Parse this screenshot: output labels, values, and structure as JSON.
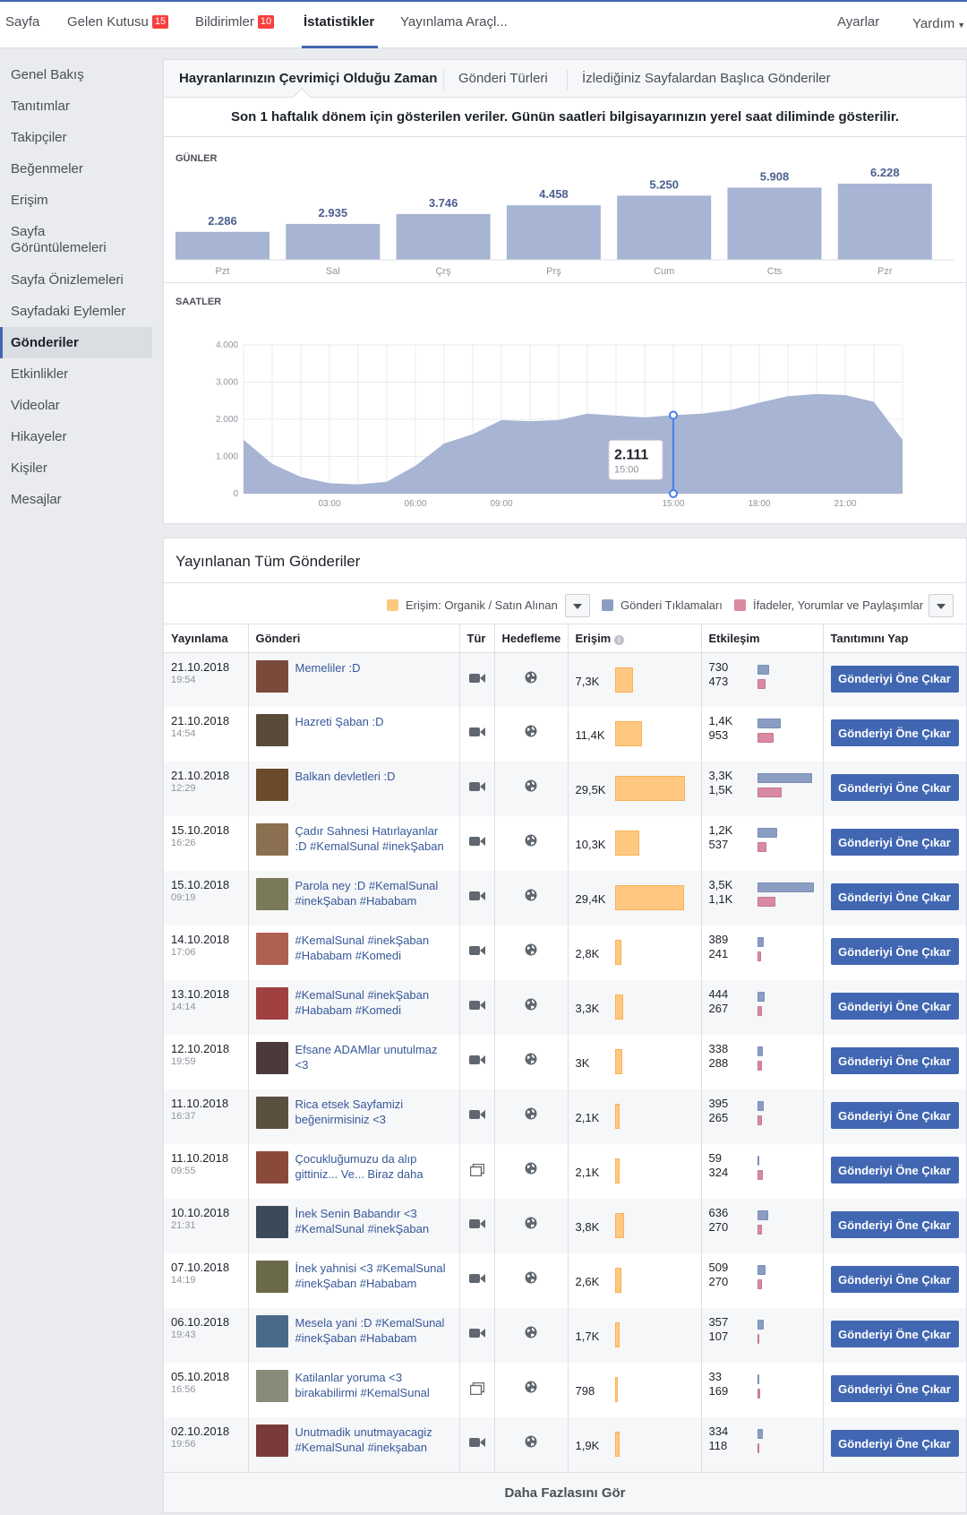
{
  "topnav": {
    "items": [
      {
        "label": "Sayfa",
        "badge": ""
      },
      {
        "label": "Gelen Kutusu",
        "badge": "15"
      },
      {
        "label": "Bildirimler",
        "badge": "10"
      },
      {
        "label": "İstatistikler",
        "badge": ""
      },
      {
        "label": "Yayınlama Araçl...",
        "badge": ""
      }
    ],
    "right": [
      "Ayarlar",
      "Yardım"
    ]
  },
  "sidebar": {
    "items": [
      "Genel Bakış",
      "Tanıtımlar",
      "Takipçiler",
      "Beğenmeler",
      "Erişim",
      "Sayfa Görüntülemeleri",
      "Sayfa Önizlemeleri",
      "Sayfadaki Eylemler",
      "Gönderiler",
      "Etkinlikler",
      "Videolar",
      "Hikayeler",
      "Kişiler",
      "Mesajlar"
    ],
    "active": "Gönderiler"
  },
  "insights": {
    "tabs": [
      "Hayranlarınızın Çevrimiçi Olduğu Zaman",
      "Gönderi Türleri",
      "İzlediğiniz Sayfalardan Başlıca Gönderiler"
    ],
    "info": "Son 1 haftalık dönem için gösterilen veriler. Günün saatleri bilgisayarınızın yerel saat diliminde gösterilir.",
    "days_label": "GÜNLER",
    "hours_label": "SAATLER"
  },
  "chart_data": [
    {
      "type": "bar",
      "title": "GÜNLER",
      "categories": [
        "Pzt",
        "Sal",
        "Çrş",
        "Prş",
        "Cum",
        "Cts",
        "Pzr"
      ],
      "values": [
        2286,
        2935,
        3746,
        4458,
        5250,
        5908,
        6228
      ],
      "labels": [
        "2.286",
        "2.935",
        "3.746",
        "4.458",
        "5.250",
        "5.908",
        "6.228"
      ],
      "color": "#a7b4d3"
    },
    {
      "type": "area",
      "title": "SAATLER",
      "x": [
        0,
        1,
        2,
        3,
        4,
        5,
        6,
        7,
        8,
        9,
        10,
        11,
        12,
        13,
        14,
        15,
        16,
        17,
        18,
        19,
        20,
        21,
        22,
        23
      ],
      "values": [
        1450,
        800,
        450,
        280,
        250,
        320,
        750,
        1350,
        1600,
        1980,
        1950,
        1980,
        2150,
        2100,
        2050,
        2111,
        2150,
        2250,
        2450,
        2620,
        2680,
        2650,
        2470,
        1450
      ],
      "xticks": [
        "03:00",
        "06:00",
        "09:00",
        "15:00",
        "18:00",
        "21:00"
      ],
      "xtick_positions": [
        3,
        6,
        9,
        15,
        18,
        21
      ],
      "yticks": [
        "0",
        "1.000",
        "2.000",
        "3.000",
        "4.000"
      ],
      "ylim": [
        0,
        4000
      ],
      "tooltip": {
        "value": "2.111",
        "time": "15:00",
        "x": 15
      },
      "color": "#a7b4d3",
      "grid": true
    }
  ],
  "posts": {
    "title": "Yayınlanan Tüm Gönderiler",
    "legend": [
      "Erişim: Organik / Satın Alınan",
      "Gönderi Tıklamaları",
      "İfadeler, Yorumlar ve Paylaşımlar"
    ],
    "legend_colors": [
      "#ffc880",
      "#8b9dc3",
      "#d88aa0"
    ],
    "columns": [
      "Yayınlama",
      "Gönderi",
      "Tür",
      "Hedefleme",
      "Erişim",
      "Etkileşim",
      "Tanıtımını Yap"
    ],
    "boost_label": "Gönderiyi Öne Çıkar",
    "more_label": "Daha Fazlasını Gör",
    "rows": [
      {
        "date": "21.10.2018",
        "time": "19:54",
        "text": "Memeliler :D",
        "type": "video",
        "reach": "7,3K",
        "reach_pct": 0.25,
        "clicks": "730",
        "engage": "473",
        "clicks_pct": 0.22,
        "engage_pct": 0.14,
        "thumb": "#7a4a3a"
      },
      {
        "date": "21.10.2018",
        "time": "14:54",
        "text": "Hazreti Şaban :D",
        "type": "video",
        "reach": "11,4K",
        "reach_pct": 0.39,
        "clicks": "1,4K",
        "engage": "953",
        "clicks_pct": 0.42,
        "engage_pct": 0.29,
        "thumb": "#5a4a3a"
      },
      {
        "date": "21.10.2018",
        "time": "12:29",
        "text": "Balkan devletleri :D",
        "type": "video",
        "reach": "29,5K",
        "reach_pct": 1.0,
        "clicks": "3,3K",
        "engage": "1,5K",
        "clicks_pct": 1.0,
        "engage_pct": 0.45,
        "thumb": "#6a4a2a"
      },
      {
        "date": "15.10.2018",
        "time": "16:26",
        "text": "Çadır Sahnesi Hatırlayanlar :D #KemalSunal #inekŞaban",
        "type": "video",
        "reach": "10,3K",
        "reach_pct": 0.35,
        "clicks": "1,2K",
        "engage": "537",
        "clicks_pct": 0.36,
        "engage_pct": 0.16,
        "thumb": "#8a7050"
      },
      {
        "date": "15.10.2018",
        "time": "09:19",
        "text": "Parola ney :D #KemalSunal #inekŞaban #Hababam",
        "type": "video",
        "reach": "29,4K",
        "reach_pct": 0.99,
        "clicks": "3,5K",
        "engage": "1,1K",
        "clicks_pct": 1.04,
        "engage_pct": 0.33,
        "thumb": "#7a7a5a"
      },
      {
        "date": "14.10.2018",
        "time": "17:06",
        "text": "#KemalSunal #inekŞaban #Hababam #Komedi",
        "type": "video",
        "reach": "2,8K",
        "reach_pct": 0.09,
        "clicks": "389",
        "engage": "241",
        "clicks_pct": 0.12,
        "engage_pct": 0.07,
        "thumb": "#b06050"
      },
      {
        "date": "13.10.2018",
        "time": "14:14",
        "text": "#KemalSunal #inekŞaban #Hababam #Komedi",
        "type": "video",
        "reach": "3,3K",
        "reach_pct": 0.11,
        "clicks": "444",
        "engage": "267",
        "clicks_pct": 0.13,
        "engage_pct": 0.08,
        "thumb": "#a04040"
      },
      {
        "date": "12.10.2018",
        "time": "19:59",
        "text": "Efsane ADAMlar unutulmaz <3",
        "type": "video",
        "reach": "3K",
        "reach_pct": 0.1,
        "clicks": "338",
        "engage": "288",
        "clicks_pct": 0.1,
        "engage_pct": 0.09,
        "thumb": "#4a3a3a"
      },
      {
        "date": "11.10.2018",
        "time": "16:37",
        "text": "Rica etsek Sayfamizi beğenirmisiniz <3",
        "type": "video",
        "reach": "2,1K",
        "reach_pct": 0.07,
        "clicks": "395",
        "engage": "265",
        "clicks_pct": 0.12,
        "engage_pct": 0.08,
        "thumb": "#5a5040"
      },
      {
        "date": "11.10.2018",
        "time": "09:55",
        "text": "Çocukluğumuzu da alıp gittiniz... Ve... Biraz daha",
        "type": "album",
        "reach": "2,1K",
        "reach_pct": 0.07,
        "clicks": "59",
        "engage": "324",
        "clicks_pct": 0.02,
        "engage_pct": 0.1,
        "thumb": "#8a4a3a"
      },
      {
        "date": "10.10.2018",
        "time": "21:31",
        "text": "İnek Senin Babandır <3 #KemalSunal #inekŞaban",
        "type": "video",
        "reach": "3,8K",
        "reach_pct": 0.13,
        "clicks": "636",
        "engage": "270",
        "clicks_pct": 0.19,
        "engage_pct": 0.08,
        "thumb": "#3a4a5a"
      },
      {
        "date": "07.10.2018",
        "time": "14:19",
        "text": "İnek yahnisi <3 #KemalSunal #inekŞaban #Hababam",
        "type": "video",
        "reach": "2,6K",
        "reach_pct": 0.09,
        "clicks": "509",
        "engage": "270",
        "clicks_pct": 0.15,
        "engage_pct": 0.08,
        "thumb": "#6a6a4a"
      },
      {
        "date": "06.10.2018",
        "time": "19:43",
        "text": "Mesela yani :D #KemalSunal #inekŞaban #Hababam",
        "type": "video",
        "reach": "1,7K",
        "reach_pct": 0.06,
        "clicks": "357",
        "engage": "107",
        "clicks_pct": 0.11,
        "engage_pct": 0.03,
        "thumb": "#4a6a8a"
      },
      {
        "date": "05.10.2018",
        "time": "16:56",
        "text": "Katilanlar yoruma <3 birakabilirmi #KemalSunal",
        "type": "album",
        "reach": "798",
        "reach_pct": 0.03,
        "clicks": "33",
        "engage": "169",
        "clicks_pct": 0.01,
        "engage_pct": 0.05,
        "thumb": "#8a8a7a"
      },
      {
        "date": "02.10.2018",
        "time": "19:56",
        "text": "Unutmadik unutmayacagiz #KemalSunal #inekşaban",
        "type": "video",
        "reach": "1,9K",
        "reach_pct": 0.06,
        "clicks": "334",
        "engage": "118",
        "clicks_pct": 0.1,
        "engage_pct": 0.04,
        "thumb": "#7a3a3a"
      }
    ]
  }
}
